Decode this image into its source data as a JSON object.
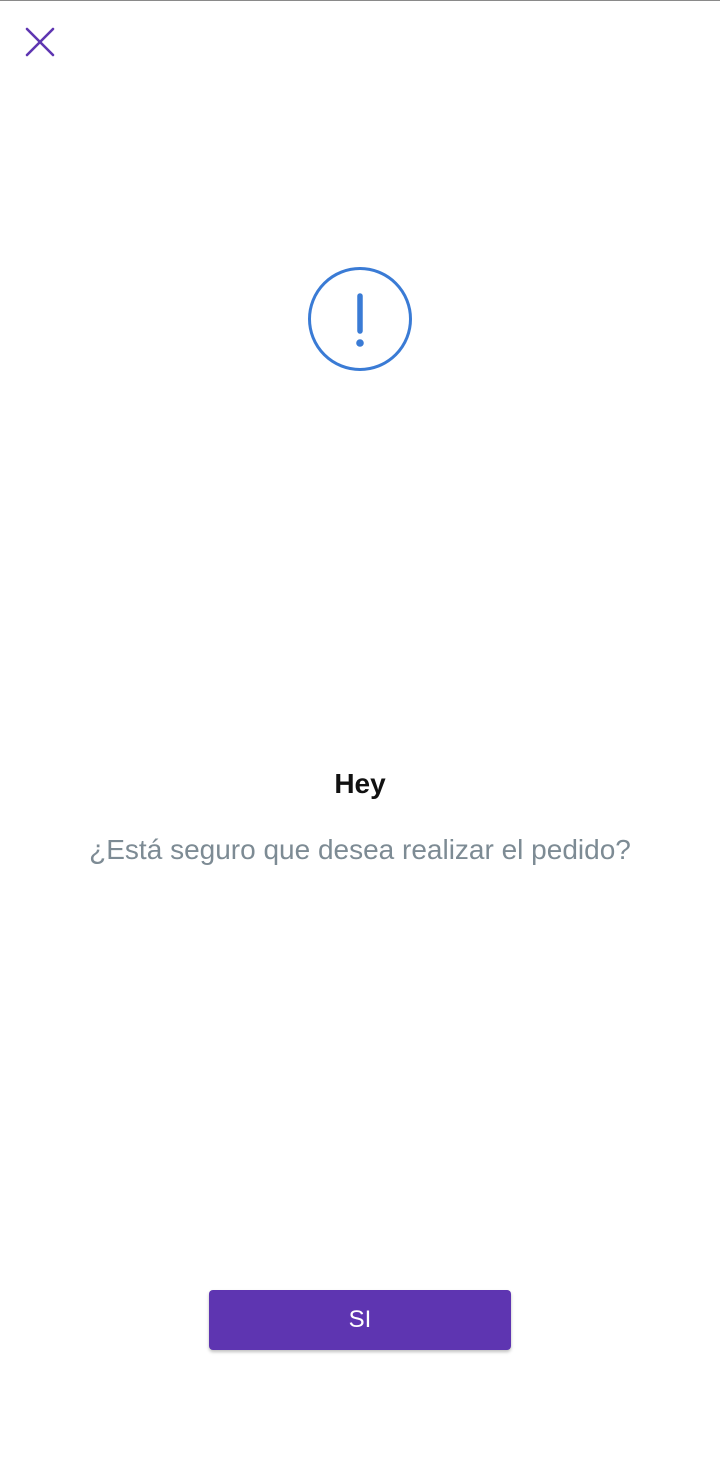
{
  "dialog": {
    "close_icon": "close-icon",
    "alert_icon": "exclamation-circle-icon",
    "title": "Hey",
    "message": "¿Está seguro que desea realizar el pedido?",
    "confirm_label": "SI"
  },
  "colors": {
    "accent": "#5e35b1",
    "alert": "#3a7bd5",
    "message_text": "#7d8b94",
    "title_text": "#111111"
  }
}
